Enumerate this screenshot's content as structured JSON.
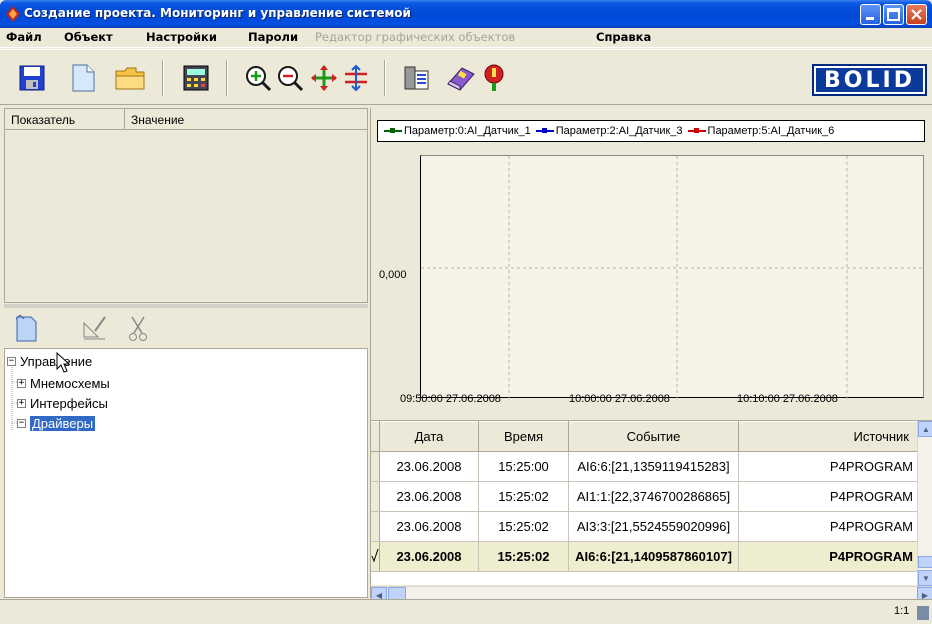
{
  "window": {
    "title": "Создание проекта. Мониторинг и управление системой"
  },
  "menu": {
    "items": [
      {
        "label": "Файл",
        "enabled": true
      },
      {
        "label": "Объект",
        "enabled": true
      },
      {
        "label": "Настройки",
        "enabled": true
      },
      {
        "label": "Пароли",
        "enabled": true
      },
      {
        "label": "Редактор графических объектов",
        "enabled": false
      },
      {
        "label": "Справка",
        "enabled": true
      }
    ]
  },
  "toolbar": {
    "icons": [
      "save-icon",
      "new-document-icon",
      "open-folder-icon",
      "calculator-icon",
      "zoom-in-icon",
      "zoom-out-icon",
      "move-icon",
      "resize-icon",
      "settings-list-icon",
      "notebook-icon",
      "info-marker-icon"
    ],
    "logo_text": "BOLID"
  },
  "indicators": {
    "columns": [
      "Показатель",
      "Значение"
    ]
  },
  "tree": {
    "root": "Управление",
    "children": [
      "Мнемосхемы",
      "Интерфейсы",
      "Драйверы"
    ],
    "selected": "Драйверы"
  },
  "chart_data": {
    "type": "line",
    "legend": [
      {
        "name": "Параметр:0:AI_Датчик_1",
        "color": "#006400"
      },
      {
        "name": "Параметр:2:AI_Датчик_3",
        "color": "#0000cc"
      },
      {
        "name": "Параметр:5:AI_Датчик_6",
        "color": "#d00000"
      }
    ],
    "y_ticks": [
      "0,000"
    ],
    "x_ticks": [
      "09:50:00 27.06.2008",
      "10:00:00 27.06.2008",
      "10:10:00 27.06.2008"
    ],
    "grid": true,
    "series": []
  },
  "events_table": {
    "columns": [
      "Дата",
      "Время",
      "Событие",
      "Источник"
    ],
    "rows": [
      {
        "date": "23.06.2008",
        "time": "15:25:00",
        "event": "AI6:6:[21,1359119415283]",
        "source": "P4PROGRAM"
      },
      {
        "date": "23.06.2008",
        "time": "15:25:02",
        "event": "AI1:1:[22,3746700286865]",
        "source": "P4PROGRAM"
      },
      {
        "date": "23.06.2008",
        "time": "15:25:02",
        "event": "AI3:3:[21,5524559020996]",
        "source": "P4PROGRAM"
      },
      {
        "date": "23.06.2008",
        "time": "15:25:02",
        "event": "AI6:6:[21,1409587860107]",
        "source": "P4PROGRAM",
        "selected": true
      }
    ]
  },
  "status": {
    "zoom": "1:1"
  },
  "colors": {
    "title_bar": "#0047d6",
    "selection": "#316ac5",
    "logo_bg": "#0b3a9c"
  }
}
